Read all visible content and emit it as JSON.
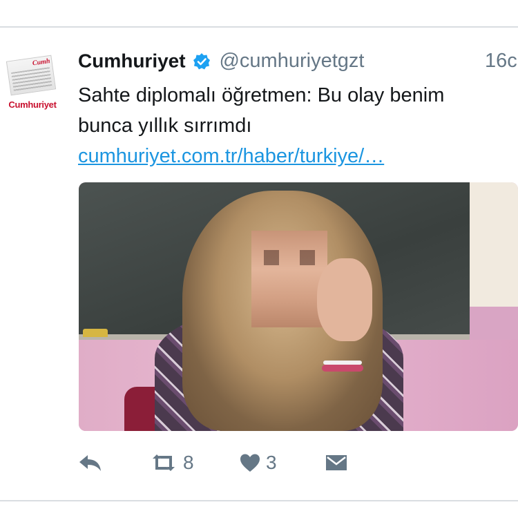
{
  "tweet": {
    "author": {
      "avatar_brand": "Cumhuriyet",
      "avatar_masthead": "Cumh",
      "display_name": "Cumhuriyet",
      "verified": true,
      "handle": "@cumhuriyetgzt"
    },
    "timestamp": "16c",
    "text_line1": "Sahte diplomalı öğretmen: Bu olay benim",
    "text_line2": "bunca yıllık sırrımdı",
    "link": "cumhuriyet.com.tr/haber/turkiye/…",
    "actions": {
      "reply_icon": "reply-icon",
      "retweet_icon": "retweet-icon",
      "retweet_count": "8",
      "like_icon": "heart-icon",
      "like_count": "3",
      "dm_icon": "envelope-icon"
    }
  },
  "colors": {
    "text": "#14171a",
    "muted": "#657786",
    "link": "#1b95e0",
    "verified": "#1da1f2",
    "brand_red": "#c8102e"
  }
}
